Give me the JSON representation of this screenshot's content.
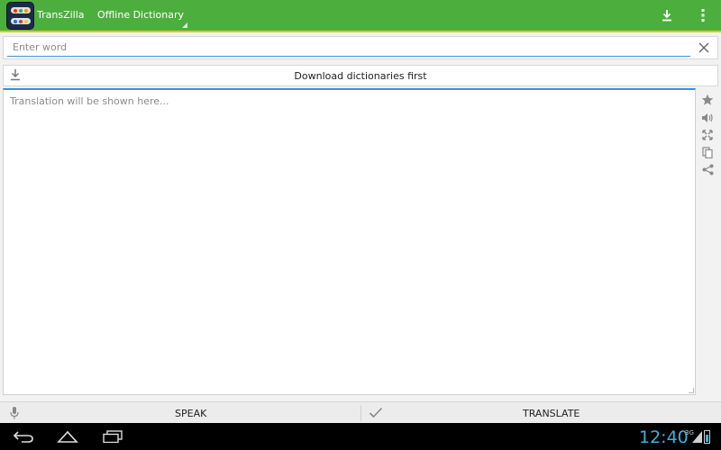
{
  "app": {
    "title": "TransZilla",
    "mode_selector": "Offline Dictionary",
    "icons": {
      "app": "transzilla-app-icon",
      "download": "download-icon",
      "overflow": "overflow-menu-icon"
    }
  },
  "search": {
    "placeholder": "Enter word",
    "value": "",
    "clear_icon": "clear-icon"
  },
  "download_bar": {
    "label": "Download dictionaries first",
    "icon": "download-icon"
  },
  "translation": {
    "placeholder": "Translation will be shown here...",
    "tools": [
      "star-icon",
      "speaker-icon",
      "fullscreen-icon",
      "copy-icon",
      "share-icon"
    ]
  },
  "bottom": {
    "speak_label": "SPEAK",
    "translate_label": "TRANSLATE",
    "speak_icon": "microphone-icon",
    "translate_icon": "checkmark-icon"
  },
  "system": {
    "clock": "12:40",
    "network": "3G",
    "nav": [
      "back-icon",
      "home-icon",
      "recents-icon"
    ]
  },
  "colors": {
    "action_bar": "#4caf3d",
    "accent_line": "#e8c21a",
    "focus": "#3a8fd9",
    "clock": "#3fb0e0"
  }
}
